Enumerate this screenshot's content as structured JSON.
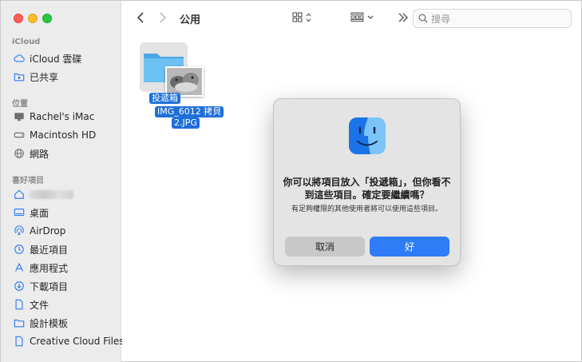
{
  "window": {
    "title": "公用"
  },
  "sidebar": {
    "sections": [
      {
        "label": "iCloud",
        "items": [
          {
            "label": "iCloud 雲碟",
            "icon": "cloud-icon"
          },
          {
            "label": "已共享",
            "icon": "shared-folder-icon"
          }
        ]
      },
      {
        "label": "位置",
        "items": [
          {
            "label": "Rachel's iMac",
            "icon": "imac-icon"
          },
          {
            "label": "Macintosh HD",
            "icon": "disk-icon"
          },
          {
            "label": "網路",
            "icon": "network-icon"
          }
        ]
      },
      {
        "label": "喜好項目",
        "items": [
          {
            "label": "",
            "icon": "home-icon"
          },
          {
            "label": "桌面",
            "icon": "desktop-icon"
          },
          {
            "label": "AirDrop",
            "icon": "airdrop-icon"
          },
          {
            "label": "最近項目",
            "icon": "clock-icon"
          },
          {
            "label": "應用程式",
            "icon": "apps-icon"
          },
          {
            "label": "下載項目",
            "icon": "download-icon"
          },
          {
            "label": "文件",
            "icon": "document-icon"
          },
          {
            "label": "設計模板",
            "icon": "folder-icon"
          },
          {
            "label": "Creative Cloud Files",
            "icon": "document-icon"
          }
        ]
      }
    ]
  },
  "toolbar": {
    "search_placeholder": "搜尋"
  },
  "content": {
    "folder_label": "投遞箱",
    "file_label_line1": "IMG_6012 拷貝",
    "file_label_line2": "2.JPG"
  },
  "dialog": {
    "title": "你可以將項目放入「投遞箱」，但你看不到這些項目。確定要繼續嗎？",
    "message": "有足夠權限的其他使用者將可以使用這些項目。",
    "cancel_label": "取消",
    "ok_label": "好"
  },
  "colors": {
    "accent": "#2f7cf6",
    "sidebar_icon": "#2f7cf6",
    "selection": "#1f6fd9"
  }
}
